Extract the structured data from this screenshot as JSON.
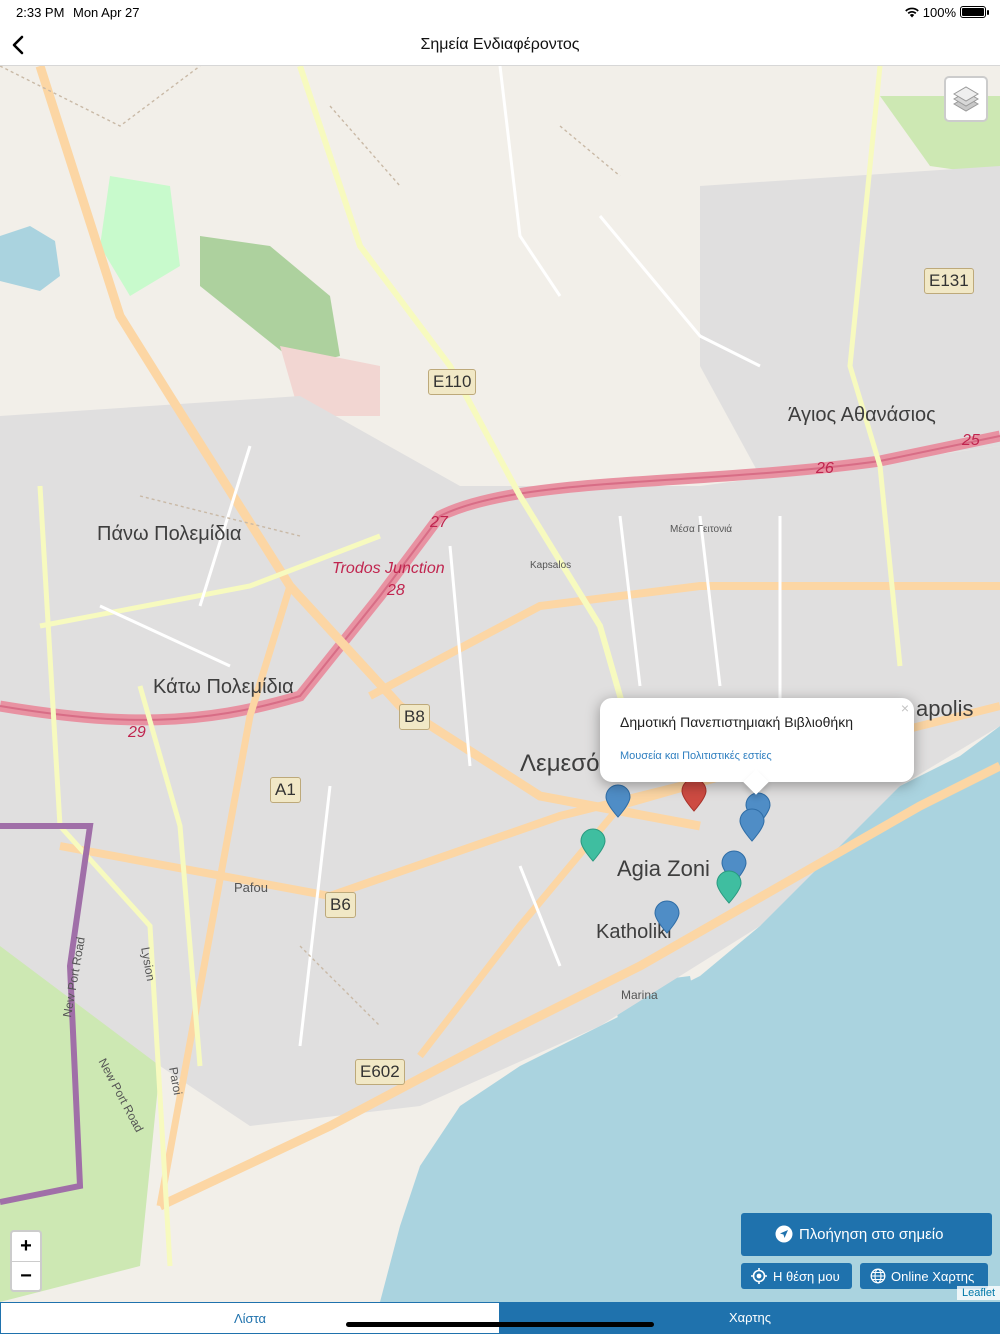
{
  "status_bar": {
    "time": "2:33 PM",
    "date": "Mon Apr 27",
    "battery": "100%"
  },
  "header": {
    "title": "Σημεία Ενδιαφέροντος"
  },
  "map": {
    "place_labels": [
      "Πάνω Πολεμίδια",
      "Κάτω Πολεμίδια",
      "Άγιος Αθανάσιος",
      "Λεμεσό",
      "Agia Zoni",
      "Katholiki",
      "Marina",
      "apolis",
      "Kapsalos",
      "Μέσα Γειτονιά",
      "Pafou"
    ],
    "road_labels": [
      "Trodos Junction",
      "28",
      "27",
      "26",
      "25",
      "29"
    ],
    "shields": [
      "E110",
      "E131",
      "B8",
      "A1",
      "B6",
      "E602"
    ],
    "street_labels": [
      "Lysion",
      "Paroi",
      "New Port Road",
      "New Port Road"
    ],
    "marker_colors": {
      "blue": "#4f8dc6",
      "green": "#3fbea0",
      "red": "#cd4b42"
    }
  },
  "popup": {
    "title": "Δημοτική Πανεπιστημιακή Βιβλιοθήκη",
    "category": "Μουσεία και Πολιτιστικές εστίες",
    "close": "×"
  },
  "controls": {
    "zoom_in": "+",
    "zoom_out": "−",
    "navigate": "Πλοήγηση στο σημείο",
    "my_location": "Η θέση μου",
    "online_maps": "Online Χαρτης",
    "attribution": "Leaflet"
  },
  "tabs": {
    "list": "Λίστα",
    "map": "Χαρτης"
  },
  "accent_color": "#1f72ad"
}
